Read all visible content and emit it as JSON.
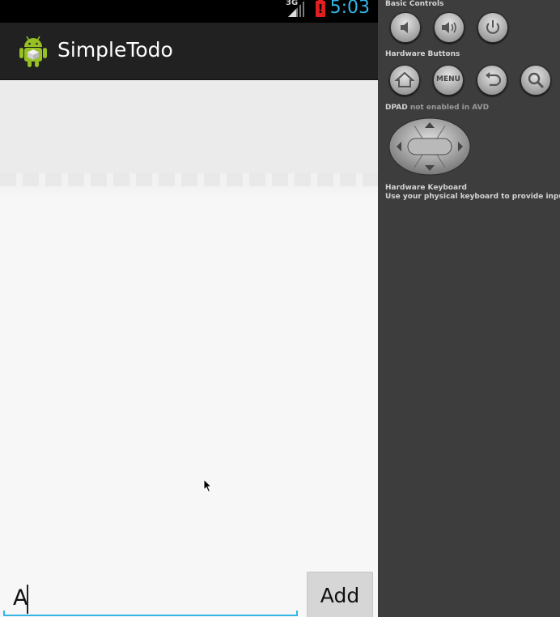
{
  "status_bar": {
    "network": "3G",
    "battery_alert": "!",
    "time": "5:03"
  },
  "app": {
    "title": "SimpleTodo"
  },
  "new_item": {
    "value": "A"
  },
  "add_button": {
    "label": "Add"
  },
  "controls": {
    "basic_title": "Basic Controls",
    "hardware_title": "Hardware Buttons",
    "menu_label": "MENU",
    "dpad_title": "DPAD",
    "dpad_note": "not enabled in AVD",
    "keyboard_title": "Hardware Keyboard",
    "keyboard_note": "Use your physical keyboard to provide input"
  },
  "colors": {
    "accent": "#33b5e5",
    "action_bar": "#212121",
    "panel": "#3d3d3d",
    "battery_warning": "#e02020"
  },
  "icons": [
    "signal-icon",
    "battery-alert-icon",
    "android-app-icon",
    "volume-down-icon",
    "volume-up-icon",
    "power-icon",
    "home-icon",
    "back-icon",
    "search-icon",
    "dpad-icon",
    "mouse-cursor-icon"
  ]
}
